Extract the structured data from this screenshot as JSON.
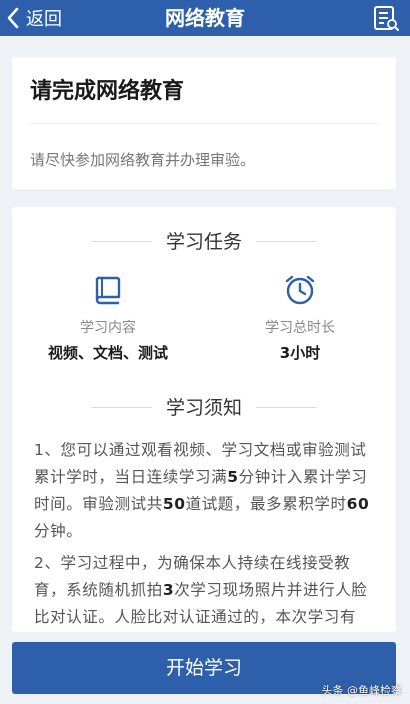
{
  "nav": {
    "back_label": "返回",
    "title": "网络教育",
    "bg_color": "#2d5fab"
  },
  "status_card": {
    "title": "请完成网络教育",
    "description": "请尽快参加网络教育并办理审验。"
  },
  "task_section": {
    "heading": "学习任务",
    "items": [
      {
        "icon": "book-icon",
        "label": "学习内容",
        "value": "视频、文档、测试"
      },
      {
        "icon": "alarm-clock-icon",
        "label": "学习总时长",
        "value": "3小时"
      }
    ]
  },
  "notice_section": {
    "heading": "学习须知",
    "p1": {
      "a": "1、您可以通过观看视频、学习文档或审验测试累计学时，当日连续学习满",
      "b": "5",
      "c": "分钟计入累计学习时间。审验测试共",
      "d": "50",
      "e": "道试题，最多累积学时",
      "f": "60",
      "g": "分钟。"
    },
    "p2": {
      "a": "2、学习过程中，为确保本人持续在线接受教育，系统随机抓拍",
      "b": "3",
      "c": "次学习现场照片并进行人脸比对认证。人脸比对认证通过的，本次学习有"
    }
  },
  "start_button": {
    "label": "开始学习"
  },
  "watermark": "头条 @鱼峰检察",
  "colors": {
    "accent": "#2d5fab",
    "background": "#eef1f6",
    "card": "#ffffff"
  }
}
